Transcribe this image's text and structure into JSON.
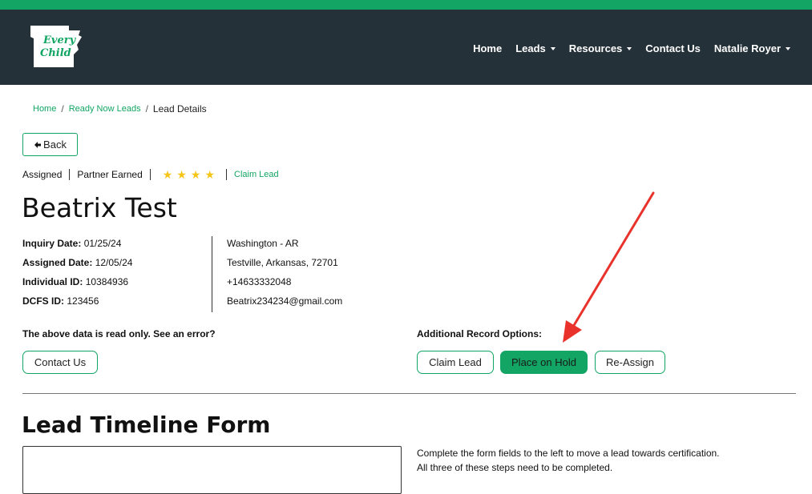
{
  "brand": {
    "logo_text": "Every Child",
    "accent": "#12a563",
    "nav_bg": "#253139"
  },
  "nav": {
    "items": [
      {
        "label": "Home",
        "dropdown": false
      },
      {
        "label": "Leads",
        "dropdown": true
      },
      {
        "label": "Resources",
        "dropdown": true
      },
      {
        "label": "Contact Us",
        "dropdown": false
      },
      {
        "label": "Natalie Royer",
        "dropdown": true
      }
    ]
  },
  "breadcrumb": {
    "home": "Home",
    "ready_now": "Ready Now Leads",
    "current": "Lead Details"
  },
  "back_button": "Back",
  "status": {
    "assigned": "Assigned",
    "partner": "Partner Earned",
    "stars": 4,
    "claim_link": "Claim Lead"
  },
  "lead": {
    "name": "Beatrix Test",
    "inquiry_label": "Inquiry Date:",
    "inquiry_value": "01/25/24",
    "assigned_label": "Assigned Date:",
    "assigned_value": "12/05/24",
    "individual_label": "Individual ID:",
    "individual_value": "10384936",
    "dcfs_label": "DCFS ID:",
    "dcfs_value": "123456",
    "county": "Washington - AR",
    "address": "Testville, Arkansas, 72701",
    "phone": "+14633332048",
    "email": "Beatrix234234@gmail.com"
  },
  "readonly_note": "The above data is read only. See an error?",
  "contact_button": "Contact Us",
  "options": {
    "label": "Additional Record Options:",
    "claim": "Claim Lead",
    "hold": "Place on Hold",
    "reassign": "Re-Assign"
  },
  "timeline": {
    "title": "Lead Timeline Form",
    "instruction_1": "Complete the form fields to the left to move a lead towards certification.",
    "instruction_2": "All three of these steps need to be completed."
  }
}
